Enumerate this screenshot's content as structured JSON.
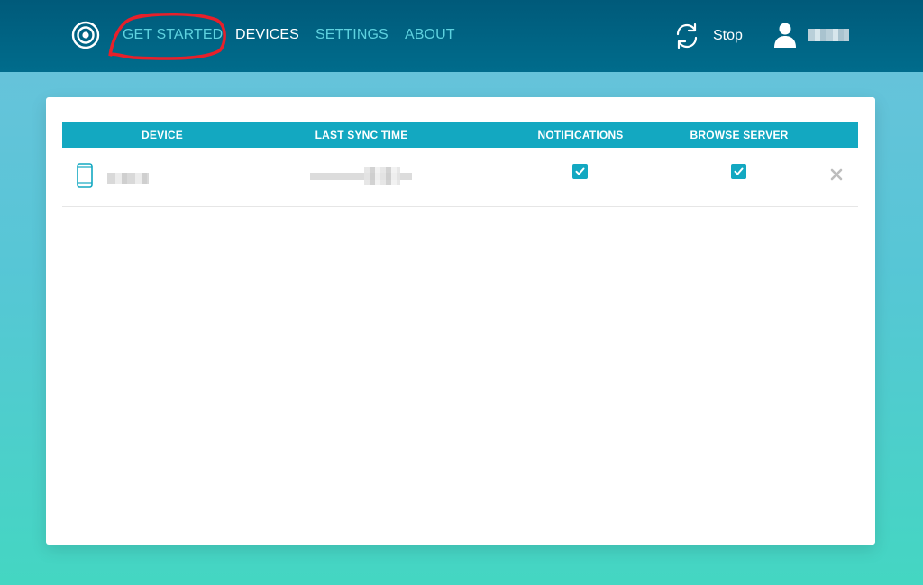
{
  "nav": {
    "items": [
      {
        "label": "GET STARTED",
        "active": false
      },
      {
        "label": "DEVICES",
        "active": true
      },
      {
        "label": "SETTINGS",
        "active": false
      },
      {
        "label": "ABOUT",
        "active": false
      }
    ]
  },
  "sync": {
    "label": "Stop",
    "icon": "sync-icon"
  },
  "user": {
    "icon": "user-icon"
  },
  "table": {
    "headers": [
      "DEVICE",
      "LAST SYNC TIME",
      "NOTIFICATIONS",
      "BROWSE SERVER"
    ],
    "rows": [
      {
        "device_icon": "phone-icon",
        "notifications": true,
        "browse_server": true
      }
    ]
  },
  "colors": {
    "header_bg": "#006c8c",
    "accent": "#13a8c1",
    "nav_inactive": "#5ed2df",
    "annotation": "#e8202a"
  }
}
